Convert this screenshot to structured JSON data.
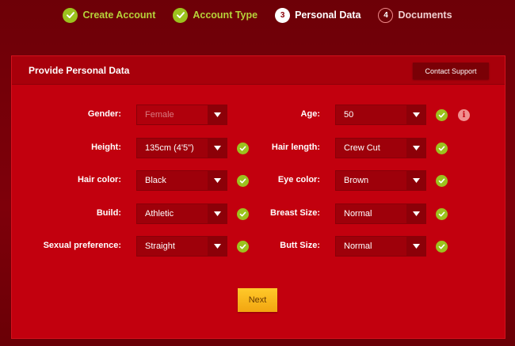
{
  "stepper": {
    "steps": [
      {
        "number": "",
        "label": "Create Account",
        "state": "done"
      },
      {
        "number": "",
        "label": "Account Type",
        "state": "done"
      },
      {
        "number": "3",
        "label": "Personal Data",
        "state": "active"
      },
      {
        "number": "4",
        "label": "Documents",
        "state": "pending"
      }
    ]
  },
  "card": {
    "title": "Provide Personal Data",
    "support_label": "Contact Support"
  },
  "form": {
    "left": [
      {
        "label": "Gender:",
        "value": "Female",
        "disabled": true,
        "check": false
      },
      {
        "label": "Height:",
        "value": "135cm (4'5\")",
        "disabled": false,
        "check": true
      },
      {
        "label": "Hair color:",
        "value": "Black",
        "disabled": false,
        "check": true
      },
      {
        "label": "Build:",
        "value": "Athletic",
        "disabled": false,
        "check": true
      },
      {
        "label": "Sexual preference:",
        "value": "Straight",
        "disabled": false,
        "check": true
      }
    ],
    "right": [
      {
        "label": "Age:",
        "value": "50",
        "disabled": false,
        "check": true,
        "info": true
      },
      {
        "label": "Hair length:",
        "value": "Crew Cut",
        "disabled": false,
        "check": true
      },
      {
        "label": "Eye color:",
        "value": "Brown",
        "disabled": false,
        "check": true
      },
      {
        "label": "Breast Size:",
        "value": "Normal",
        "disabled": false,
        "check": true
      },
      {
        "label": "Butt Size:",
        "value": "Normal",
        "disabled": false,
        "check": true
      }
    ],
    "info_glyph": "i"
  },
  "next_label": "Next",
  "colors": {
    "accent_green": "#9cc21e",
    "card_red": "#c2000e",
    "button_yellow": "#f2a510"
  }
}
